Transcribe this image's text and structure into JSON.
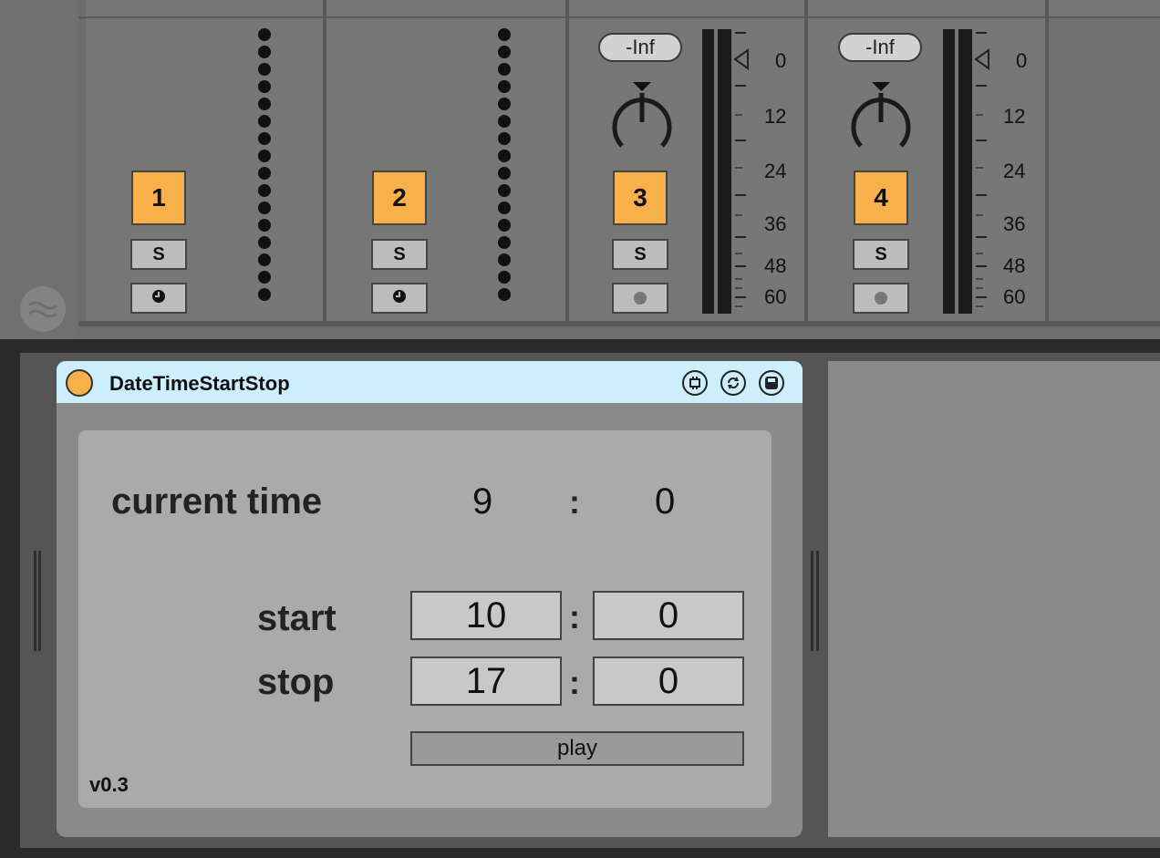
{
  "mixer": {
    "tracks": [
      {
        "number": "1",
        "solo": "S"
      },
      {
        "number": "2",
        "solo": "S"
      },
      {
        "number": "3",
        "solo": "S",
        "peak": "-Inf"
      },
      {
        "number": "4",
        "solo": "S",
        "peak": "-Inf"
      }
    ],
    "meter_scale": [
      "0",
      "12",
      "24",
      "36",
      "48",
      "60"
    ]
  },
  "device": {
    "title": "DateTimeStartStop",
    "current_time_label": "current time",
    "current_hour": "9",
    "current_minute": "0",
    "separator": ":",
    "start_label": "start",
    "start_hour": "10",
    "start_minute": "0",
    "stop_label": "stop",
    "stop_hour": "17",
    "stop_minute": "0",
    "play_label": "play",
    "version": "v0.3",
    "accent_color": "#f7b04a",
    "header_color": "#cdeefd"
  }
}
